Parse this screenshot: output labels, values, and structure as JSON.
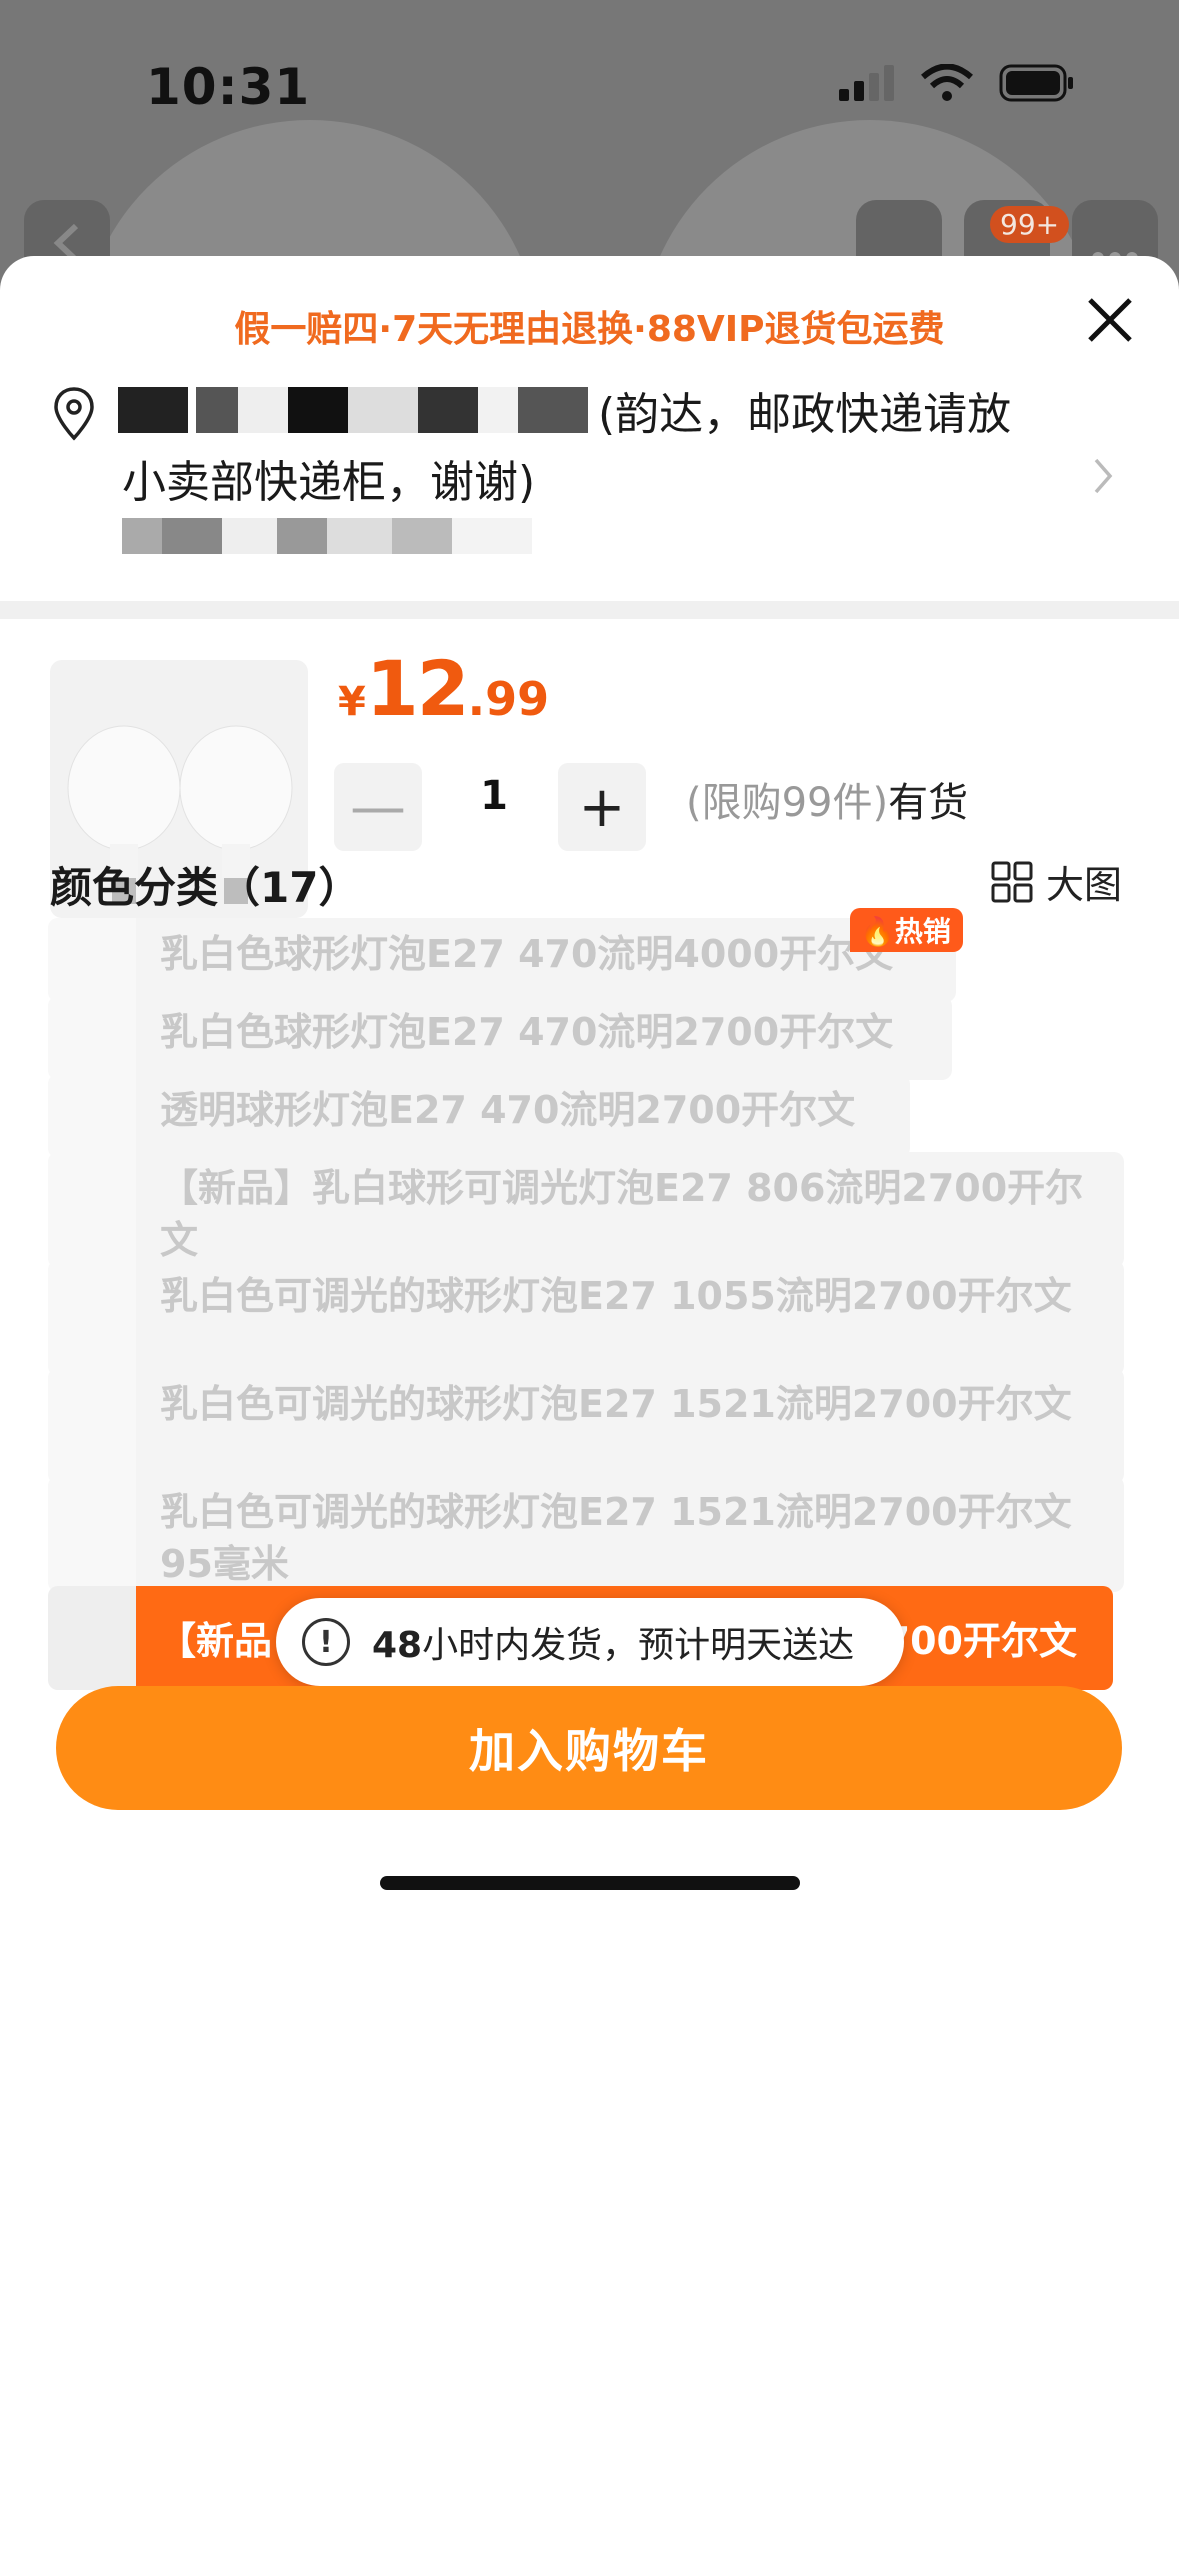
{
  "status_bar": {
    "time": "10:31"
  },
  "background": {
    "cart_badge": "99+"
  },
  "sheet": {
    "promo": "假一赔四·7天无理由退换·88VIP退货包运费",
    "address": {
      "note": "(韵达，邮政快递请放",
      "line2": "小卖部快递柜，谢谢)"
    },
    "price": {
      "currency": "¥",
      "integer": "12",
      "decimal": ".99"
    },
    "quantity": {
      "value": "1",
      "minus_symbol": "—",
      "plus_symbol": "+"
    },
    "limit": {
      "text": "(限购99件)",
      "stock": "有货"
    },
    "section": {
      "title": "颜色分类（17）",
      "big_view_label": "大图"
    },
    "hot_badge": "热销",
    "options": [
      {
        "label": "乳白色球形灯泡E27 470流明4000开尔文"
      },
      {
        "label": "乳白色球形灯泡E27 470流明2700开尔文"
      },
      {
        "label": "透明球形灯泡E27 470流明2700开尔文"
      },
      {
        "label": "【新品】乳白球形可调光灯泡E27 806流明2700开尔文"
      },
      {
        "label": "乳白色可调光的球形灯泡E27 1055流明2700开尔文"
      },
      {
        "label": "乳白色可调光的球形灯泡E27 1521流明2700开尔文"
      },
      {
        "label": "乳白色可调光的球形灯泡E27 1521流明2700开尔文95毫米"
      }
    ],
    "selected_option": {
      "label_left": "【新品",
      "label_right": "700开尔文"
    },
    "toast": {
      "highlight": "48",
      "text": "小时内发货，预计明天送达"
    },
    "cta_label": "加入购物车"
  },
  "colors": {
    "accent_orange": "#ff8c14",
    "price_orange": "#f05a0f",
    "promo_orange": "#f06a1f"
  }
}
